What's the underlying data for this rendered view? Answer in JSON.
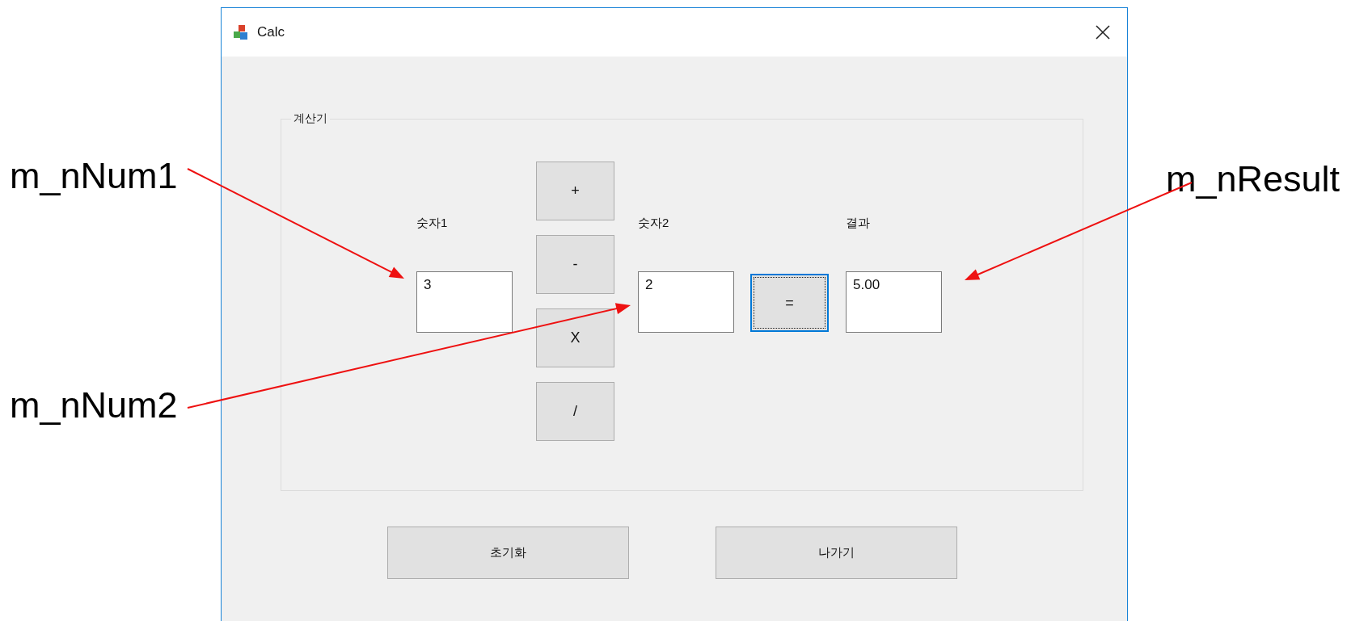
{
  "window": {
    "title": "Calc"
  },
  "group": {
    "label": "계산기"
  },
  "operators": [
    {
      "label": "+"
    },
    {
      "label": "-"
    },
    {
      "label": "X"
    },
    {
      "label": "/"
    }
  ],
  "fields": [
    {
      "label": "숫자1",
      "value": "3"
    },
    {
      "label": "숫자2",
      "value": "2"
    },
    {
      "label": "결과",
      "value": "5.00"
    }
  ],
  "equals_button": {
    "label": "=",
    "focused": true
  },
  "buttons": [
    {
      "label": "초기화"
    },
    {
      "label": "나가기"
    }
  ],
  "annotations": [
    {
      "text": "m_nNum1"
    },
    {
      "text": "m_nNum2"
    },
    {
      "text": "m_nResult"
    }
  ]
}
